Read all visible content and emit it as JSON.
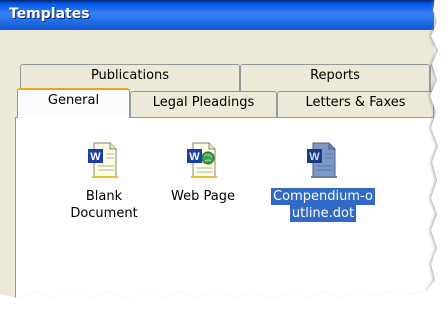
{
  "window": {
    "title": "Templates"
  },
  "tabs_back": [
    {
      "label": "Publications"
    },
    {
      "label": "Reports"
    }
  ],
  "tabs_front": [
    {
      "label": "General",
      "active": true
    },
    {
      "label": "Legal Pleadings",
      "active": false
    },
    {
      "label": "Letters & Faxes",
      "active": false
    }
  ],
  "templates": [
    {
      "label_line1": "Blank",
      "label_line2": "Document",
      "icon": "word-document-icon",
      "selected": false
    },
    {
      "label_line1": "Web Page",
      "label_line2": "",
      "icon": "word-webpage-icon",
      "selected": false
    },
    {
      "label_line1": "Compendium-o",
      "label_line2": "utline.dot",
      "icon": "word-template-icon",
      "selected": true
    }
  ],
  "colors": {
    "titlebar": "#0058ee",
    "dialog_bg": "#ece9d8",
    "tab_highlight": "#f0a21b",
    "selection": "#316ac5"
  }
}
